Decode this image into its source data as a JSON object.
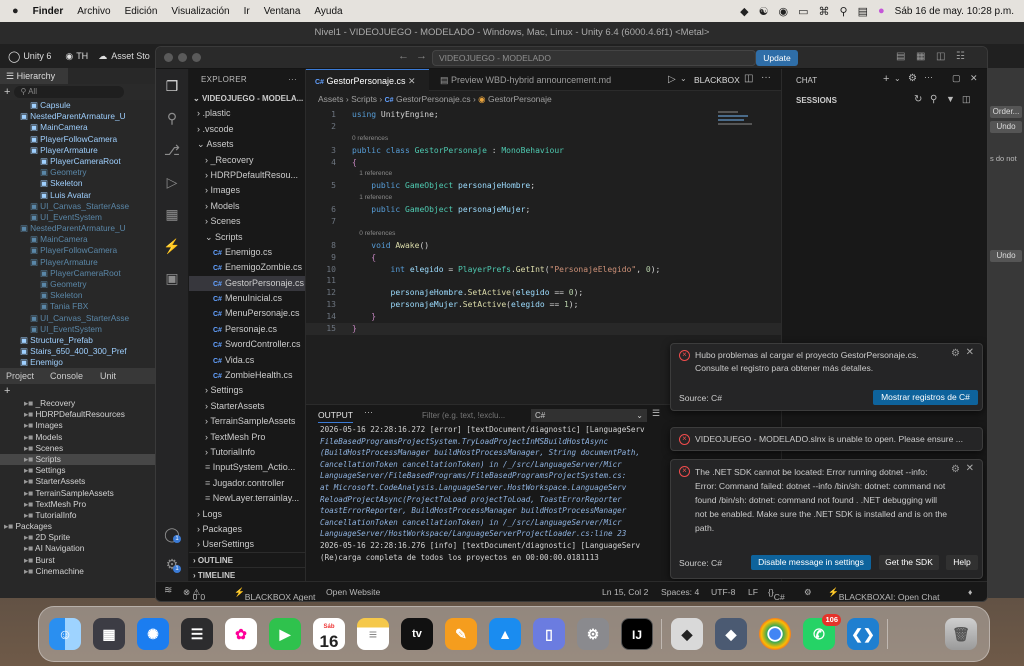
{
  "menubar": {
    "app": "Finder",
    "items": [
      "Archivo",
      "Edición",
      "Visualización",
      "Ir",
      "Ventana",
      "Ayuda"
    ],
    "clock": "Sáb 16 de may.  10:28 p.m."
  },
  "unity": {
    "title": "Nivel1 - VIDEOJUEGO - MODELADO - Windows, Mac, Linux - Unity 6.4 (6000.4.6f1) <Metal>",
    "version": "Unity 6",
    "account": "TH",
    "asset_store": "Asset Sto",
    "hierarchy_tab": "Hierarchy",
    "hierarchy_search": "All",
    "hierarchy": [
      {
        "label": "Capsule",
        "indent": 3,
        "state": "on"
      },
      {
        "label": "NestedParentArmature_U",
        "indent": 2,
        "state": "on"
      },
      {
        "label": "MainCamera",
        "indent": 3,
        "state": "on"
      },
      {
        "label": "PlayerFollowCamera",
        "indent": 3,
        "state": "on"
      },
      {
        "label": "PlayerArmature",
        "indent": 3,
        "state": "on"
      },
      {
        "label": "PlayerCameraRoot",
        "indent": 4,
        "state": "on"
      },
      {
        "label": "Geometry",
        "indent": 4,
        "state": "dim"
      },
      {
        "label": "Skeleton",
        "indent": 4,
        "state": "on"
      },
      {
        "label": "Luis Avatar",
        "indent": 4,
        "state": "on"
      },
      {
        "label": "UI_Canvas_StarterAsse",
        "indent": 3,
        "state": "dim"
      },
      {
        "label": "UI_EventSystem",
        "indent": 3,
        "state": "dim"
      },
      {
        "label": "NestedParentArmature_U",
        "indent": 2,
        "state": "dim"
      },
      {
        "label": "MainCamera",
        "indent": 3,
        "state": "dim"
      },
      {
        "label": "PlayerFollowCamera",
        "indent": 3,
        "state": "dim"
      },
      {
        "label": "PlayerArmature",
        "indent": 3,
        "state": "dim"
      },
      {
        "label": "PlayerCameraRoot",
        "indent": 4,
        "state": "dim"
      },
      {
        "label": "Geometry",
        "indent": 4,
        "state": "dim"
      },
      {
        "label": "Skeleton",
        "indent": 4,
        "state": "dim"
      },
      {
        "label": "Tania FBX",
        "indent": 4,
        "state": "dim"
      },
      {
        "label": "UI_Canvas_StarterAsse",
        "indent": 3,
        "state": "dim"
      },
      {
        "label": "UI_EventSystem",
        "indent": 3,
        "state": "dim"
      },
      {
        "label": "Structure_Prefab",
        "indent": 2,
        "state": "on"
      },
      {
        "label": "Stairs_650_400_300_Pref",
        "indent": 2,
        "state": "on"
      },
      {
        "label": "Enemigo",
        "indent": 2,
        "state": "on"
      },
      {
        "label": "Canvas",
        "indent": 2,
        "state": "on"
      }
    ],
    "project_tabs": [
      "Project",
      "Console",
      "Unit"
    ],
    "project": [
      {
        "label": "_Recovery",
        "indent": 2
      },
      {
        "label": "HDRPDefaultResources",
        "indent": 2
      },
      {
        "label": "Images",
        "indent": 2
      },
      {
        "label": "Models",
        "indent": 2
      },
      {
        "label": "Scenes",
        "indent": 2
      },
      {
        "label": "Scripts",
        "indent": 2,
        "sel": true
      },
      {
        "label": "Settings",
        "indent": 2
      },
      {
        "label": "StarterAssets",
        "indent": 2
      },
      {
        "label": "TerrainSampleAssets",
        "indent": 2
      },
      {
        "label": "TextMesh Pro",
        "indent": 2
      },
      {
        "label": "TutorialInfo",
        "indent": 2
      },
      {
        "label": "Packages",
        "indent": 0
      },
      {
        "label": "2D Sprite",
        "indent": 2
      },
      {
        "label": "AI Navigation",
        "indent": 2
      },
      {
        "label": "Burst",
        "indent": 2
      },
      {
        "label": "Cinemachine",
        "indent": 2
      }
    ],
    "right_labels": [
      "Order...",
      "Undo",
      "s do not",
      "Undo"
    ]
  },
  "vscode": {
    "search": "VIDEOJUEGO - MODELADO",
    "update_label": "Update",
    "explorer_title": "EXPLORER",
    "workspace": "VIDEOJUEGO - MODELA...",
    "tree": [
      {
        "label": ".plastic",
        "type": "folder",
        "indent": 1
      },
      {
        "label": ".vscode",
        "type": "folder",
        "indent": 1
      },
      {
        "label": "Assets",
        "type": "folder-open",
        "indent": 1
      },
      {
        "label": "_Recovery",
        "type": "folder",
        "indent": 2
      },
      {
        "label": "HDRPDefaultResou...",
        "type": "folder",
        "indent": 2
      },
      {
        "label": "Images",
        "type": "folder",
        "indent": 2
      },
      {
        "label": "Models",
        "type": "folder",
        "indent": 2
      },
      {
        "label": "Scenes",
        "type": "folder",
        "indent": 2
      },
      {
        "label": "Scripts",
        "type": "folder-open",
        "indent": 2
      },
      {
        "label": "Enemigo.cs",
        "type": "cs",
        "indent": 3
      },
      {
        "label": "EnemigoZombie.cs",
        "type": "cs",
        "indent": 3
      },
      {
        "label": "GestorPersonaje.cs",
        "type": "cs",
        "indent": 3,
        "sel": true
      },
      {
        "label": "MenuInicial.cs",
        "type": "cs",
        "indent": 3
      },
      {
        "label": "MenuPersonaje.cs",
        "type": "cs",
        "indent": 3
      },
      {
        "label": "Personaje.cs",
        "type": "cs",
        "indent": 3
      },
      {
        "label": "SwordController.cs",
        "type": "cs",
        "indent": 3
      },
      {
        "label": "Vida.cs",
        "type": "cs",
        "indent": 3
      },
      {
        "label": "ZombieHealth.cs",
        "type": "cs",
        "indent": 3
      },
      {
        "label": "Settings",
        "type": "folder",
        "indent": 2
      },
      {
        "label": "StarterAssets",
        "type": "folder",
        "indent": 2
      },
      {
        "label": "TerrainSampleAssets",
        "type": "folder",
        "indent": 2
      },
      {
        "label": "TextMesh Pro",
        "type": "folder",
        "indent": 2
      },
      {
        "label": "TutorialInfo",
        "type": "folder",
        "indent": 2
      },
      {
        "label": "InputSystem_Actio...",
        "type": "file",
        "indent": 2
      },
      {
        "label": "Jugador.controller",
        "type": "file",
        "indent": 2
      },
      {
        "label": "NewLayer.terrainlay...",
        "type": "file",
        "indent": 2
      },
      {
        "label": "Logs",
        "type": "folder",
        "indent": 1
      },
      {
        "label": "Packages",
        "type": "folder",
        "indent": 1
      },
      {
        "label": "UserSettings",
        "type": "folder",
        "indent": 1
      }
    ],
    "outline": "OUTLINE",
    "timeline": "TIMELINE",
    "tabs": [
      "GestorPersonaje.cs",
      "Preview WBD-hybrid announcement.md"
    ],
    "blackbox": "BLACKBOX",
    "breadcrumb": [
      "Assets",
      "Scripts",
      "GestorPersonaje.cs",
      "GestorPersonaje"
    ],
    "code": [
      {
        "n": "1",
        "html": "<span class=\"kw\">using</span> UnityEngine;"
      },
      {
        "n": "2",
        "html": ""
      },
      {
        "hint": "0 references"
      },
      {
        "n": "3",
        "html": "<span class=\"kw\">public</span> <span class=\"kw\">class</span> <span class=\"ty\">GestorPersonaje</span> : <span class=\"ty\">MonoBehaviour</span>"
      },
      {
        "n": "4",
        "html": "<span class=\"pl\">{</span>"
      },
      {
        "hint": "    1 reference"
      },
      {
        "n": "5",
        "html": "    <span class=\"kw\">public</span> <span class=\"ty\">GameObject</span> <span class=\"vr\">personajeHombre</span>;"
      },
      {
        "hint": "    1 reference"
      },
      {
        "n": "6",
        "html": "    <span class=\"kw\">public</span> <span class=\"ty\">GameObject</span> <span class=\"vr\">personajeMujer</span>;"
      },
      {
        "n": "7",
        "html": ""
      },
      {
        "hint": "    0 references"
      },
      {
        "n": "8",
        "html": "    <span class=\"kw\">void</span> <span class=\"fn\">Awake</span>()"
      },
      {
        "n": "9",
        "html": "    <span class=\"pl\">{</span>"
      },
      {
        "n": "10",
        "html": "        <span class=\"kw\">int</span> <span class=\"vr\">elegido</span> = <span class=\"ty\">PlayerPrefs</span>.<span class=\"fn\">GetInt</span>(<span class=\"st\">\"PersonajeElegido\"</span>, <span class=\"nu\">0</span>);"
      },
      {
        "n": "11",
        "html": ""
      },
      {
        "n": "12",
        "html": "        <span class=\"vr\">personajeHombre</span>.<span class=\"fn\">SetActive</span>(<span class=\"vr\">elegido</span> == <span class=\"nu\">0</span>);"
      },
      {
        "n": "13",
        "html": "        <span class=\"vr\">personajeMujer</span>.<span class=\"fn\">SetActive</span>(<span class=\"vr\">elegido</span> == <span class=\"nu\">1</span>);"
      },
      {
        "n": "14",
        "html": "    <span class=\"pl\">}</span>"
      },
      {
        "n": "15",
        "html": "<span class=\"pl\">}</span>",
        "cur": true
      }
    ],
    "output": {
      "title": "OUTPUT",
      "filter_placeholder": "Filter (e.g. text, !exclu...",
      "channel": "C#",
      "lines": [
        {
          "t": "2026-05-16 22:28:16.272 [error] [textDocument/diagnostic] [LanguageServ",
          "it": false
        },
        {
          "t": "    FileBasedProgramsProjectSystem.TryLoadProjectInMSBuildHostAsync",
          "it": true
        },
        {
          "t": "    (BuildHostProcessManager buildHostProcessManager, String documentPath,",
          "it": true
        },
        {
          "t": "    CancellationToken cancellationToken) in /_/src/LanguageServer/Micr",
          "it": true
        },
        {
          "t": "    LanguageServer/FileBasedPrograms/FileBasedProgramsProjectSystem.cs:",
          "it": true
        },
        {
          "t": "    at Microsoft.CodeAnalysis.LanguageServer.HostWorkspace.LanguageServ",
          "it": true
        },
        {
          "t": "    ReloadProjectAsync(ProjectToLoad projectToLoad, ToastErrorReporter",
          "it": true
        },
        {
          "t": "    toastErrorReporter, BuildHostProcessManager buildHostProcessManager",
          "it": true
        },
        {
          "t": "    CancellationToken cancellationToken) in /_/src/LanguageServer/Micr",
          "it": true
        },
        {
          "t": "    LanguageServer/HostWorkspace/LanguageServerProjectLoader.cs:line 23",
          "it": true
        },
        {
          "t": "2026-05-16 22:28:16.276 [info] [textDocument/diagnostic] [LanguageServ",
          "it": false
        },
        {
          "t": "(Re)carga completa de todos los proyectos en 00:00:00.0181113",
          "it": false
        }
      ]
    },
    "chat": {
      "title": "CHAT",
      "sessions": "SESSIONS"
    },
    "notifications": [
      {
        "message": "Hubo problemas al cargar el proyecto GestorPersonaje.cs. Consulte el registro para obtener más detalles.",
        "source": "Source: C#",
        "buttons": [
          {
            "label": "Mostrar registros de C#",
            "kind": "primary"
          }
        ]
      },
      {
        "message": "VIDEOJUEGO - MODELADO.slnx is unable to open. Please ensure ...",
        "source": "",
        "buttons": []
      },
      {
        "message": "The .NET SDK cannot be located: Error running dotnet --info: Error: Command failed: dotnet --info /bin/sh: dotnet: command not found /bin/sh: dotnet: command not found . .NET debugging will not be enabled. Make sure the .NET SDK is installed and is on the path.",
        "source": "Source: C#",
        "buttons": [
          {
            "label": "Disable message in settings",
            "kind": "primary"
          },
          {
            "label": "Get the SDK",
            "kind": "second"
          },
          {
            "label": "Help",
            "kind": "second"
          }
        ]
      }
    ],
    "status": {
      "errors": "0",
      "warnings": "0",
      "agent": "BLACKBOX Agent",
      "website": "Open Website",
      "position": "Ln 15, Col 2",
      "spaces": "Spaces: 4",
      "encoding": "UTF-8",
      "eol": "LF",
      "language": "C#",
      "chat": "BLACKBOXAI: Open Chat"
    }
  },
  "dock": {
    "calendar_month": "Sáb",
    "calendar_day": "16",
    "whatsapp_badge": "106",
    "tv": "tv",
    "jetbrains": "IJ"
  }
}
